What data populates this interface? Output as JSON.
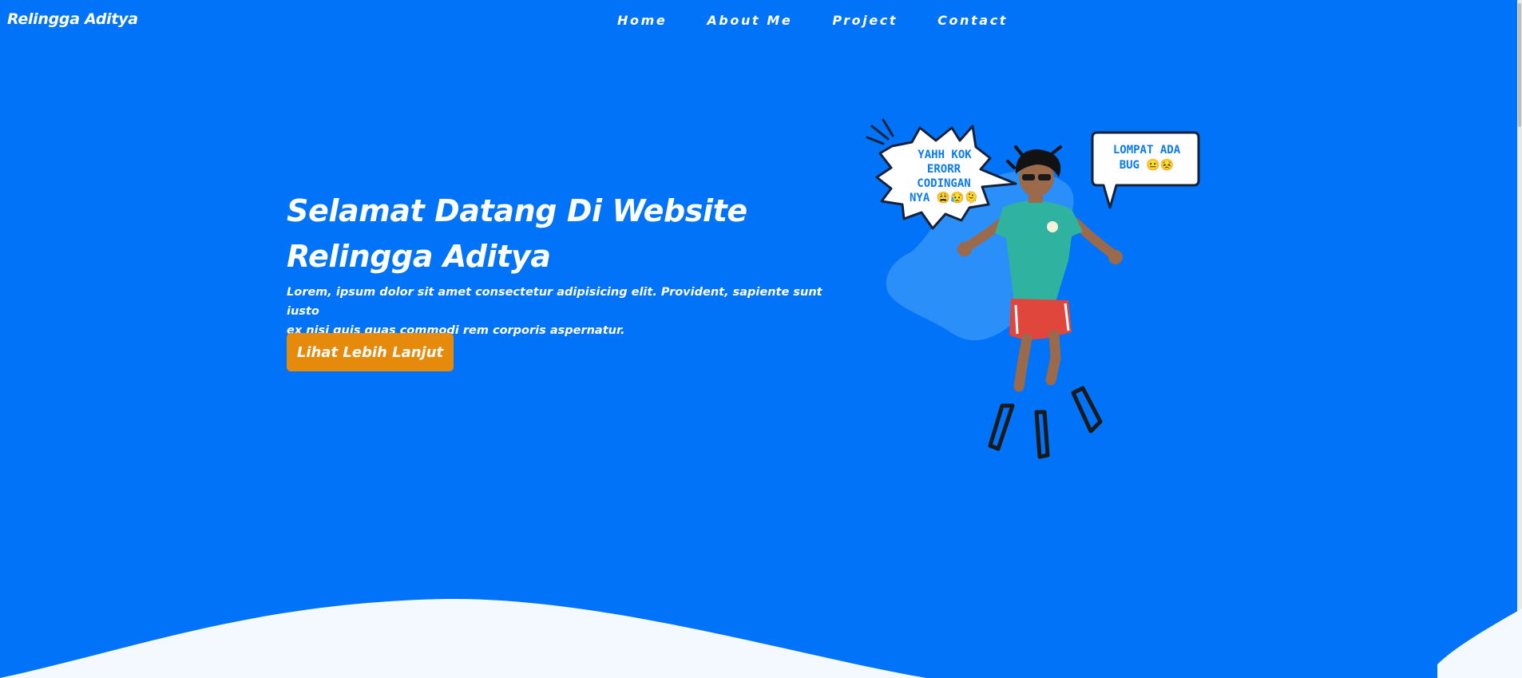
{
  "header": {
    "brand": "Relingga Aditya",
    "nav": [
      "Home",
      "About Me",
      "Project",
      "Contact"
    ]
  },
  "hero": {
    "title_line1": "Selamat Datang Di Website",
    "title_line2": "Relingga Aditya",
    "description_line1": "Lorem, ipsum dolor sit amet consectetur adipisicing elit. Provident, sapiente sunt iusto",
    "description_line2": "ex nisi quis quas commodi rem corporis aspernatur.",
    "cta_label": "Lihat Lebih Lanjut"
  },
  "illustration": {
    "bubble_left": [
      "YAHH KOK",
      "ERORR",
      "CODINGAN",
      "NYA 😩😥🫠"
    ],
    "bubble_right": [
      "LOMPAT ADA",
      "BUG 😐😣"
    ]
  },
  "colors": {
    "background": "#0073f8",
    "accent_button": "#e58a0a",
    "wave": "#f4f9ff",
    "bubble_text": "#0a7bf0"
  }
}
